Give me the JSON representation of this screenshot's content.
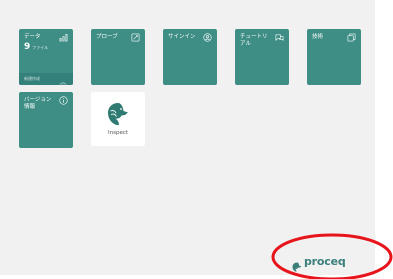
{
  "tiles": {
    "data": {
      "label": "データ",
      "count": "9",
      "unit": "ファイル",
      "new_label": "新規作成",
      "icon": "bar-chart-icon"
    },
    "probe": {
      "label": "プローブ",
      "icon": "probe-icon"
    },
    "signin": {
      "label": "サインイン",
      "icon": "user-circle-icon"
    },
    "tutorial": {
      "label": "チュートリ\nアル",
      "icon": "tutorial-icon"
    },
    "tech": {
      "label": "技術",
      "icon": "copy-icon"
    },
    "version": {
      "label": "バージョン\n情報",
      "icon": "info-icon"
    }
  },
  "app": {
    "name": "Inspect",
    "icon": "eagle-logo-icon"
  },
  "brand": {
    "name": "proceq",
    "icon": "proceq-logo-icon"
  },
  "colors": {
    "tile": "#3e8e86",
    "tile_footer": "#34807a",
    "background": "#f1f1f1",
    "brand": "#3a7f7a",
    "highlight": "#e8141b"
  }
}
